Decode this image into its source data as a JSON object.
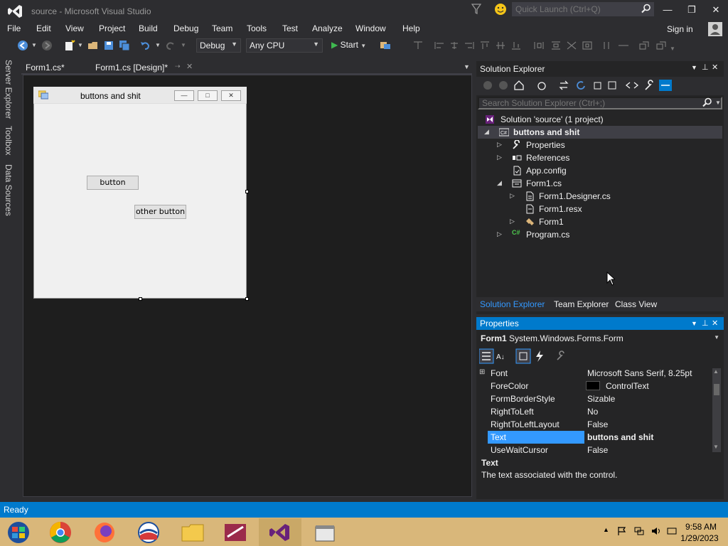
{
  "window": {
    "title": "source - Microsoft Visual Studio",
    "quick_launch_placeholder": "Quick Launch (Ctrl+Q)"
  },
  "menu": [
    "File",
    "Edit",
    "View",
    "Project",
    "Build",
    "Debug",
    "Team",
    "Tools",
    "Test",
    "Analyze",
    "Window",
    "Help"
  ],
  "account": {
    "sign_in": "Sign in"
  },
  "toolbar": {
    "configuration": "Debug",
    "platform": "Any CPU",
    "start_label": "Start"
  },
  "left_tabs": [
    "Server Explorer",
    "Toolbox",
    "Data Sources"
  ],
  "doc_tabs": [
    {
      "label": "Form1.cs*"
    },
    {
      "label": "Form1.cs [Design]*"
    }
  ],
  "designer_form": {
    "title": "buttons and shit",
    "buttons": [
      "button",
      "other button"
    ]
  },
  "solution_explorer": {
    "title": "Solution Explorer",
    "search_placeholder": "Search Solution Explorer (Ctrl+;)",
    "tree": [
      {
        "label": "Solution 'source' (1 project)"
      },
      {
        "label": "buttons and shit"
      },
      {
        "label": "Properties"
      },
      {
        "label": "References"
      },
      {
        "label": "App.config"
      },
      {
        "label": "Form1.cs"
      },
      {
        "label": "Form1.Designer.cs"
      },
      {
        "label": "Form1.resx"
      },
      {
        "label": "Form1"
      },
      {
        "label": "Program.cs"
      }
    ],
    "tabs": [
      "Solution Explorer",
      "Team Explorer",
      "Class View"
    ]
  },
  "properties": {
    "title": "Properties",
    "object_name": "Form1",
    "object_type": "System.Windows.Forms.Form",
    "rows": [
      {
        "name": "Font",
        "value": "Microsoft Sans Serif, 8.25pt"
      },
      {
        "name": "ForeColor",
        "value": "ControlText"
      },
      {
        "name": "FormBorderStyle",
        "value": "Sizable"
      },
      {
        "name": "RightToLeft",
        "value": "No"
      },
      {
        "name": "RightToLeftLayout",
        "value": "False"
      },
      {
        "name": "Text",
        "value": "buttons and shit"
      },
      {
        "name": "UseWaitCursor",
        "value": "False"
      }
    ],
    "description_title": "Text",
    "description_text": "The text associated with the control."
  },
  "status": {
    "text": "Ready"
  },
  "taskbar": {
    "time": "9:58 AM",
    "date": "1/29/2023"
  },
  "colors": {
    "accent": "#007acc",
    "selection": "#3399ff",
    "taskbar": "#d9b77a"
  }
}
